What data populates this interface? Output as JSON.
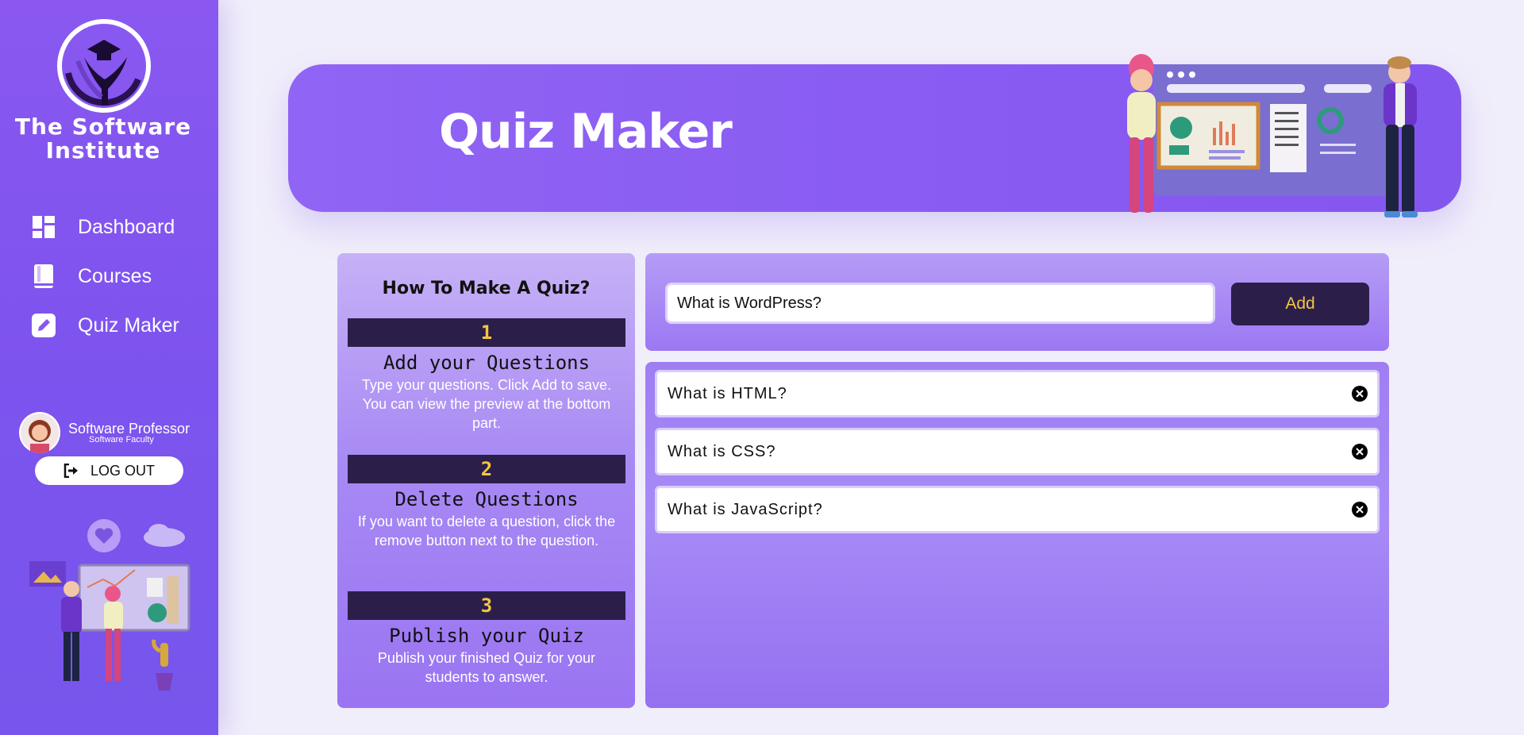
{
  "sidebar": {
    "brand": "The Software Institute",
    "nav": [
      {
        "label": "Dashboard",
        "icon": "dashboard-icon"
      },
      {
        "label": "Courses",
        "icon": "book-icon"
      },
      {
        "label": "Quiz Maker",
        "icon": "edit-icon"
      }
    ],
    "profile": {
      "name": "Software Professor",
      "role": "Software Faculty"
    },
    "logout_label": "LOG OUT"
  },
  "header": {
    "title": "Quiz Maker"
  },
  "howto": {
    "title": "How To Make A Quiz?",
    "steps": [
      {
        "num": "1",
        "heading": "Add your Questions",
        "desc": "Type your questions. Click Add to save. You can view the preview at the bottom part."
      },
      {
        "num": "2",
        "heading": "Delete Questions",
        "desc": "If you want to delete a question, click the remove button next to the question."
      },
      {
        "num": "3",
        "heading": "Publish your Quiz",
        "desc": "Publish your finished Quiz for your students to answer."
      }
    ]
  },
  "input": {
    "value": "What is WordPress?",
    "add_label": "Add"
  },
  "questions": [
    {
      "text": "What is HTML?"
    },
    {
      "text": "What is CSS?"
    },
    {
      "text": "What is JavaScript?"
    }
  ],
  "colors": {
    "accent": "#8a58f0",
    "dark": "#2b1f4a",
    "gold": "#f4c542"
  }
}
